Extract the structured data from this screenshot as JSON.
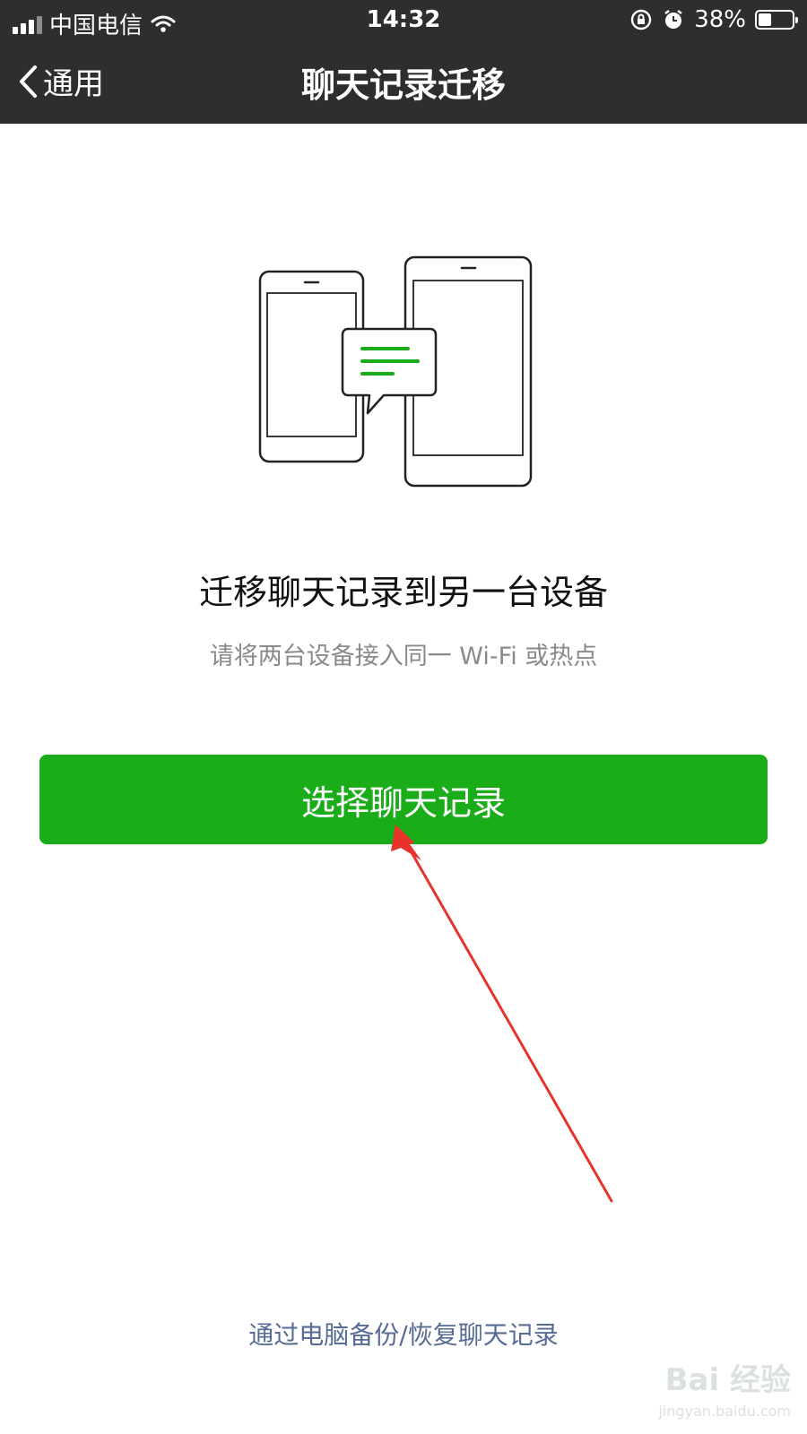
{
  "status_bar": {
    "carrier": "中国电信",
    "time": "14:32",
    "battery": "38%",
    "battery_level": 0.38,
    "icons": [
      "signal-icon",
      "wifi-icon",
      "orientation-lock-icon",
      "alarm-icon",
      "battery-icon"
    ]
  },
  "nav": {
    "back_label": "通用",
    "title": "聊天记录迁移"
  },
  "main": {
    "illustration": "phones-transfer-illustration",
    "headline": "迁移聊天记录到另一台设备",
    "subtext": "请将两台设备接入同一 Wi-Fi 或热点",
    "primary_button": "选择聊天记录"
  },
  "footer": {
    "link": "通过电脑备份/恢复聊天记录"
  },
  "watermark": {
    "main": "Bai 经验",
    "sub": "jingyan.baidu.com"
  },
  "colors": {
    "nav_bg": "#2e2e30",
    "primary": "#1aad19",
    "link": "#576b95",
    "annotation": "#e8332a",
    "illustration_accent": "#1aad19"
  }
}
